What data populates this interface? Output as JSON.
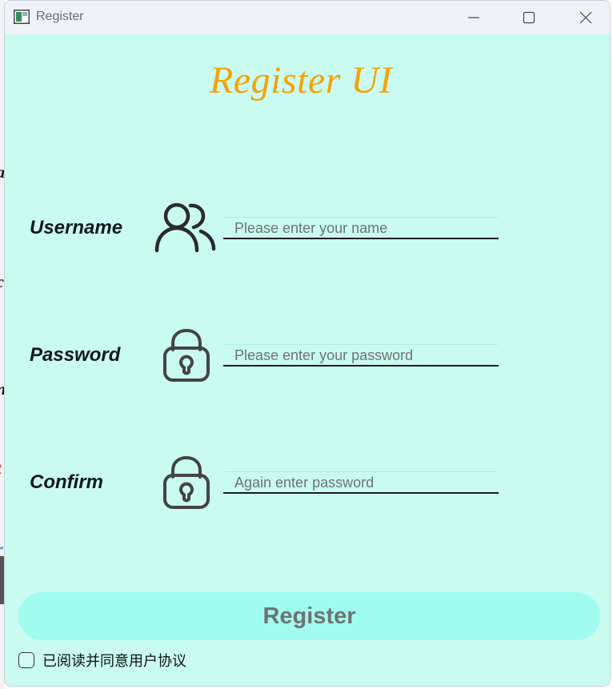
{
  "window": {
    "title": "Register",
    "controls": {
      "minimize": "minimize-icon",
      "maximize": "maximize-icon",
      "close": "close-icon"
    }
  },
  "form": {
    "heading": "Register UI",
    "fields": [
      {
        "label": "Username",
        "icon": "users-icon",
        "placeholder": "Please enter your name",
        "value": ""
      },
      {
        "label": "Password",
        "icon": "lock-icon",
        "placeholder": "Please enter your password",
        "value": ""
      },
      {
        "label": "Confirm",
        "icon": "lock-icon",
        "placeholder": "Again enter password",
        "value": ""
      }
    ],
    "submit_label": "Register",
    "agreement": {
      "label": "已阅读并同意用户协议",
      "checked": false
    }
  },
  "colors": {
    "background": "#c9fbf1",
    "heading": "#f5a20a",
    "button": "#a0fcef",
    "button_text": "#6e7470",
    "titlebar": "#eff3f8"
  }
}
